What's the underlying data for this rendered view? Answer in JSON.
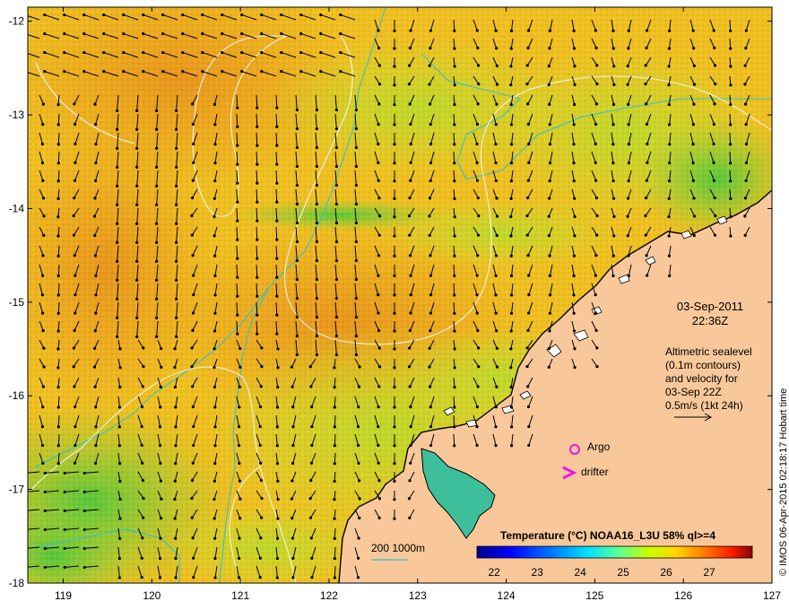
{
  "map": {
    "lon_range": [
      118.6,
      127
    ],
    "lat_range": [
      -18,
      -11.85
    ],
    "x_ticks": [
      119,
      120,
      121,
      122,
      123,
      124,
      125,
      126,
      127
    ],
    "y_ticks": [
      -12,
      -13,
      -14,
      -15,
      -16,
      -17,
      -18
    ],
    "x_tick_labels": [
      "119",
      "120",
      "121",
      "122",
      "123",
      "124",
      "125",
      "126",
      "127"
    ],
    "y_tick_labels": [
      "-12",
      "-13",
      "-14",
      "-15",
      "-16",
      "-17",
      "-18"
    ]
  },
  "annotations": {
    "date": "03-Sep-2011",
    "time": "22:36Z",
    "altimetry_lines": [
      "Altimetric sealevel",
      "(0.1m contours)",
      "and velocity for",
      "03-Sep 22Z"
    ],
    "scale_label": "0.5m/s (1kt 24h)",
    "argo_label": "Argo",
    "drifter_label": "drifter",
    "bathymetry_label": "200  1000m",
    "credit": "© IMOS 06-Apr-2015 02:18:17 Hobart time"
  },
  "colorbar": {
    "title": "Temperature (°C) NOAA16_L3U 58% ql>=4",
    "tick_values": [
      22,
      23,
      24,
      25,
      26,
      27
    ],
    "tick_labels": [
      "22",
      "23",
      "24",
      "25",
      "26",
      "27"
    ],
    "range": [
      21.6,
      28
    ]
  },
  "chart_data": {
    "type": "heatmap",
    "xlabel": "",
    "ylabel": "",
    "title": "Temperature (°C) NOAA16_L3U 58% ql>=4",
    "xlim": [
      118.6,
      127
    ],
    "ylim": [
      -18,
      -11.85
    ],
    "x_ticks": [
      119,
      120,
      121,
      122,
      123,
      124,
      125,
      126,
      127
    ],
    "y_ticks": [
      -12,
      -13,
      -14,
      -15,
      -16,
      -17,
      -18
    ],
    "colorbar_ticks": [
      22,
      23,
      24,
      25,
      26,
      27
    ],
    "markers": [
      {
        "name": "Argo",
        "lon": 124.8,
        "lat": -16.55
      },
      {
        "name": "drifter",
        "lon": 124.7,
        "lat": -16.82
      }
    ]
  },
  "colors": {
    "land": "#f8c89a",
    "contour": "#f2f2e8",
    "bathymetry": "#33c2c6",
    "argo": "#e818e8",
    "drifter": "#e818e8",
    "arrow": "#000000"
  }
}
